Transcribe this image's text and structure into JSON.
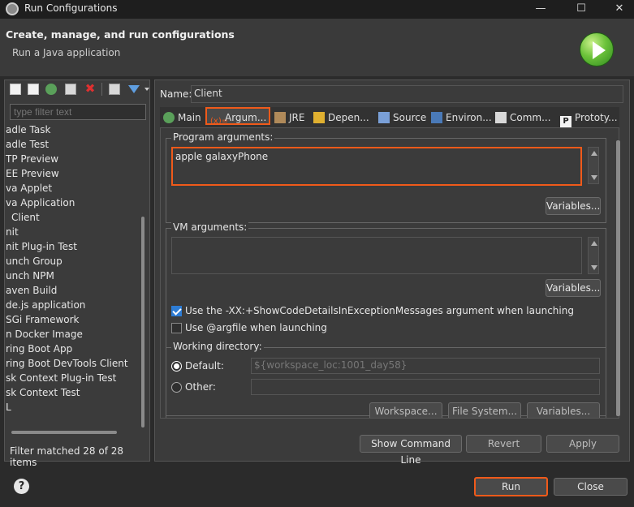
{
  "window": {
    "title": "Run Configurations",
    "minimize": "—",
    "maximize": "☐",
    "close": "✕"
  },
  "header": {
    "title": "Create, manage, and run configurations",
    "subtitle": "Run a Java application"
  },
  "left": {
    "filter_placeholder": "type filter text",
    "items": [
      "adle Task",
      "adle Test",
      "TP Preview",
      "EE Preview",
      "va Applet",
      "va Application",
      "Client",
      "nit",
      "nit Plug-in Test",
      "unch Group",
      "unch NPM",
      "aven Build",
      "de.js application",
      "SGi Framework",
      "n Docker Image",
      "ring Boot App",
      "ring Boot DevTools Client",
      "sk Context Plug-in Test",
      "sk Context Test",
      "L"
    ],
    "filter_matched": "Filter matched 28 of 28 items"
  },
  "right": {
    "name_label": "Name:",
    "name_value": "Client",
    "tabs": [
      "Main",
      "Argum...",
      "JRE",
      "Depen...",
      "Source",
      "Environ...",
      "Comm...",
      "Prototy..."
    ],
    "program_args": {
      "title": "Program arguments:",
      "value": "apple galaxyPhone",
      "variables": "Variables..."
    },
    "vm_args": {
      "title": "VM arguments:",
      "value": "",
      "variables": "Variables..."
    },
    "checkbox_xx": "Use the -XX:+ShowCodeDetailsInExceptionMessages argument when launching",
    "checkbox_argfile": "Use @argfile when launching",
    "working_dir": {
      "title": "Working directory:",
      "default_label": "Default:",
      "default_value": "${workspace_loc:1001_day58}",
      "other_label": "Other:",
      "other_value": "",
      "workspace_btn": "Workspace...",
      "filesystem_btn": "File System...",
      "variables_btn": "Variables..."
    },
    "show_cmd": "Show Command Line",
    "revert": "Revert",
    "apply": "Apply"
  },
  "footer": {
    "help": "?",
    "run": "Run",
    "close": "Close"
  },
  "colors": {
    "highlight": "#f05a1a",
    "checkbox": "#2d7cd4",
    "background": "#2b2b2b"
  }
}
